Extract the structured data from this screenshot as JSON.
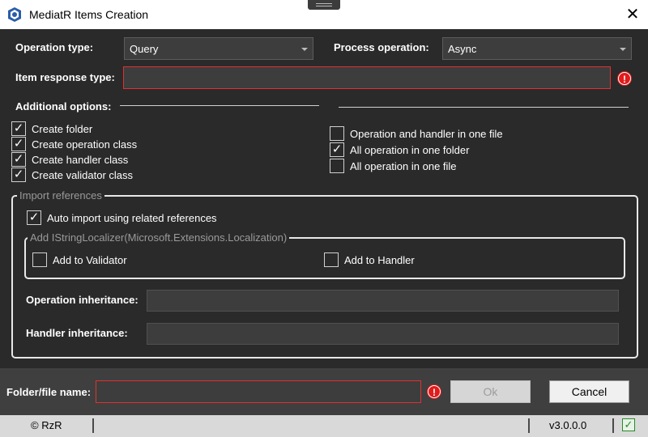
{
  "window": {
    "title": "MediatR Items Creation",
    "close_glyph": "✕"
  },
  "operation": {
    "type_label": "Operation type:",
    "type_value": "Query",
    "process_label": "Process operation:",
    "process_value": "Async",
    "response_label": "Item response type:",
    "response_value": ""
  },
  "options": {
    "title": "Additional options:",
    "left": [
      {
        "label": "Create folder",
        "checked": true
      },
      {
        "label": "Create operation class",
        "checked": true
      },
      {
        "label": "Create handler class",
        "checked": true
      },
      {
        "label": "Create validator class",
        "checked": true
      }
    ],
    "right": [
      {
        "label": "Operation and handler in one file",
        "checked": false
      },
      {
        "label": "All operation in one folder",
        "checked": true
      },
      {
        "label": "All operation in one file",
        "checked": false
      }
    ]
  },
  "imports": {
    "legend": "Import references",
    "auto_label": "Auto import using related references",
    "auto_checked": true,
    "localizer_legend": "Add IStringLocalizer(Microsoft.Extensions.Localization)",
    "validator_label": "Add to Validator",
    "validator_checked": false,
    "handler_label": "Add to Handler",
    "handler_checked": false,
    "op_inherit_label": "Operation inheritance:",
    "op_inherit_value": "",
    "handler_inherit_label": "Handler inheritance:",
    "handler_inherit_value": ""
  },
  "footer": {
    "folder_label": "Folder/file name:",
    "folder_value": "",
    "ok_label": "Ok",
    "cancel_label": "Cancel"
  },
  "status": {
    "copyright": "© RzR",
    "version": "v3.0.0.0",
    "status_glyph": "✓"
  },
  "icons": {
    "error": "!",
    "check": "✓"
  }
}
